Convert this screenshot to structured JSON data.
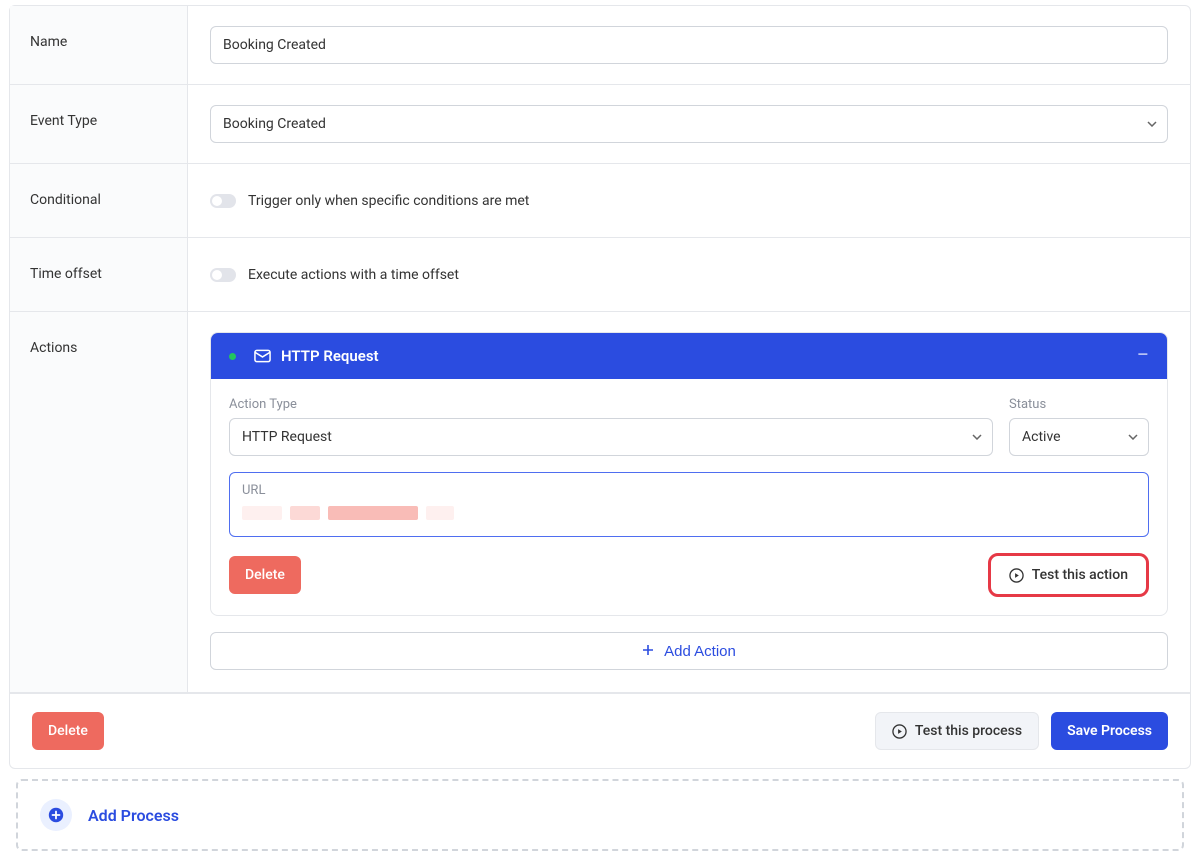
{
  "form": {
    "name_label": "Name",
    "name_value": "Booking Created",
    "event_type_label": "Event Type",
    "event_type_value": "Booking Created",
    "conditional_label": "Conditional",
    "conditional_description": "Trigger only when specific conditions are met",
    "time_offset_label": "Time offset",
    "time_offset_description": "Execute actions with a time offset",
    "actions_label": "Actions"
  },
  "action": {
    "header_title": "HTTP Request",
    "action_type_label": "Action Type",
    "action_type_value": "HTTP Request",
    "status_label": "Status",
    "status_value": "Active",
    "url_label": "URL",
    "delete_label": "Delete",
    "test_action_label": "Test this action",
    "add_action_label": "Add Action"
  },
  "footer": {
    "delete_label": "Delete",
    "test_process_label": "Test this process",
    "save_process_label": "Save Process"
  },
  "add_process": {
    "label": "Add Process"
  }
}
